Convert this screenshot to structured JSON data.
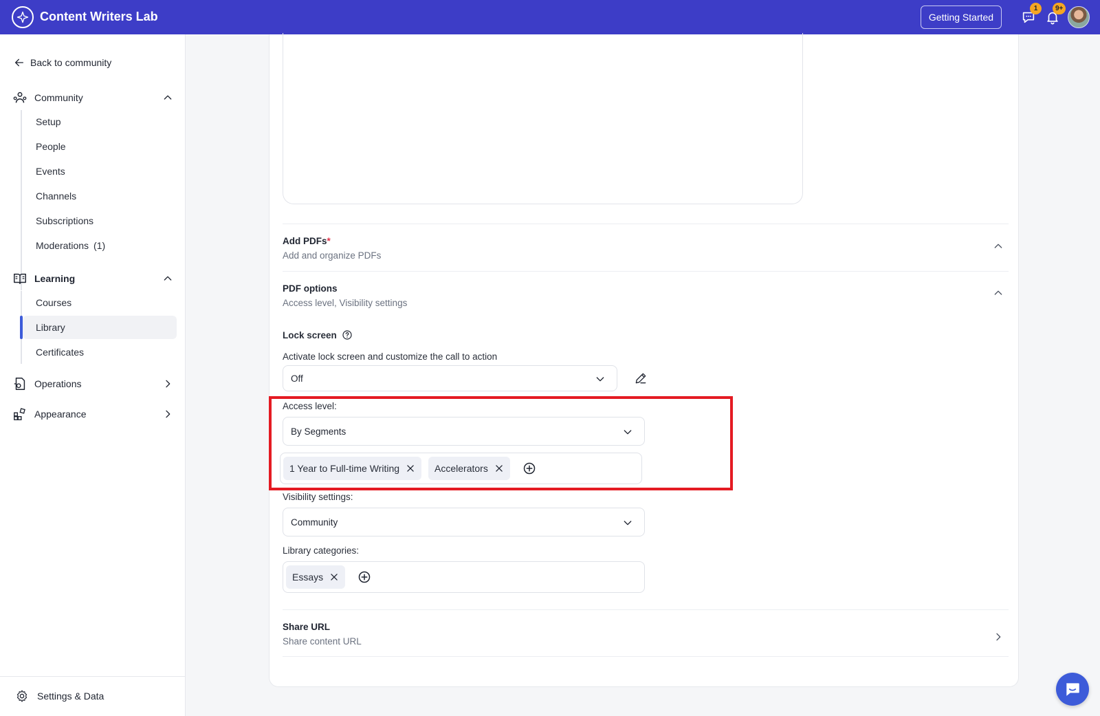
{
  "app": {
    "title": "Content Writers Lab"
  },
  "topbar": {
    "getting_started_label": "Getting Started",
    "messages_badge": "1",
    "notifications_badge": "9+",
    "accent_color": "#3d3dc7"
  },
  "sidebar": {
    "back_label": "Back to community",
    "community": {
      "label": "Community",
      "items": [
        "Setup",
        "People",
        "Events",
        "Channels",
        "Subscriptions",
        "Moderations"
      ],
      "moderations_count": "(1)"
    },
    "learning": {
      "label": "Learning",
      "items": [
        "Courses",
        "Library",
        "Certificates"
      ]
    },
    "operations_label": "Operations",
    "appearance_label": "Appearance",
    "settings_label": "Settings & Data"
  },
  "main": {
    "add_pdfs": {
      "title": "Add PDFs",
      "required_mark": "*",
      "subtitle": "Add and organize PDFs"
    },
    "pdf_options": {
      "title": "PDF options",
      "subtitle": "Access level, Visibility settings"
    },
    "lock_screen": {
      "label": "Lock screen",
      "description": "Activate lock screen and customize the call to action",
      "value": "Off"
    },
    "access_level": {
      "label": "Access level:",
      "value": "By Segments",
      "segments": [
        "1 Year to Full-time Writing",
        "Accelerators"
      ]
    },
    "visibility": {
      "label": "Visibility settings:",
      "value": "Community"
    },
    "library_categories": {
      "label": "Library categories:",
      "tags": [
        "Essays"
      ]
    },
    "share_url": {
      "title": "Share URL",
      "subtitle": "Share content URL"
    }
  }
}
